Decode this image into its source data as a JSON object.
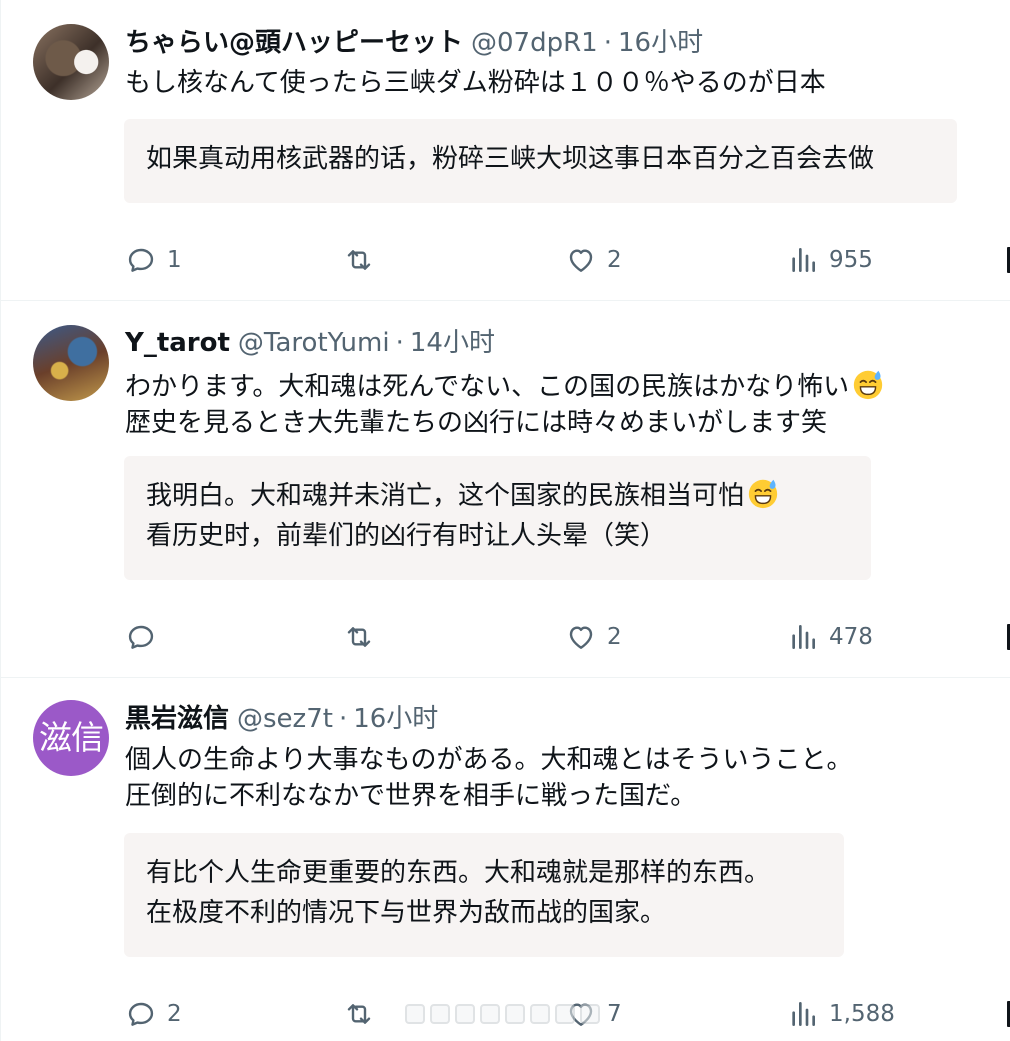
{
  "tweets": [
    {
      "avatar_kind": "photo",
      "name": "ちゃらい@頭ハッピーセット",
      "handle": "@07dpR1",
      "separator": "·",
      "time": "16小时",
      "text_lines": [
        "もし核なんて使ったら三峡ダム粉砕は１００％やるのが日本"
      ],
      "translation_lines": [
        "如果真动用核武器的话，粉碎三峡大坝这事日本百分之百会去做"
      ],
      "replies": "1",
      "retweets": "",
      "likes": "2",
      "views": "955"
    },
    {
      "avatar_kind": "photo",
      "name": "Y_tarot",
      "handle": "@TarotYumi",
      "separator": "·",
      "time": "14小时",
      "text_lines": [
        "わかります。大和魂は死んでない、この国の民族はかなり怖い",
        "歴史を見るとき大先輩たちの凶行には時々めまいがします笑"
      ],
      "translation_lines": [
        "我明白。大和魂并未消亡，这个国家的民族相当可怕",
        "看历史时，前辈们的凶行有时让人头晕（笑）"
      ],
      "emoji": "sweat-smile-emoji",
      "replies": "",
      "retweets": "",
      "likes": "2",
      "views": "478"
    },
    {
      "avatar_kind": "initials",
      "avatar_text": "滋信",
      "avatar_color": "#9b59c8",
      "name": "黒岩滋信",
      "handle": "@sez7t",
      "separator": "·",
      "time": "16小时",
      "text_lines": [
        "個人の生命より大事なものがある。大和魂とはそういうこと。",
        "圧倒的に不利ななかで世界を相手に戦った国だ。"
      ],
      "translation_lines": [
        "有比个人生命更重要的东西。大和魂就是那样的东西。",
        "在极度不利的情况下与世界为敌而战的国家。"
      ],
      "replies": "2",
      "retweets": "",
      "likes": "7",
      "views": "1,588"
    }
  ],
  "icons": {
    "reply": "reply-icon",
    "retweet": "retweet-icon",
    "like": "heart-icon",
    "views": "views-icon",
    "share": "share-icon"
  },
  "colors": {
    "text": "#0f1419",
    "secondary": "#536471",
    "divider": "#eff3f4",
    "translation_bg": "#f7f4f3"
  }
}
